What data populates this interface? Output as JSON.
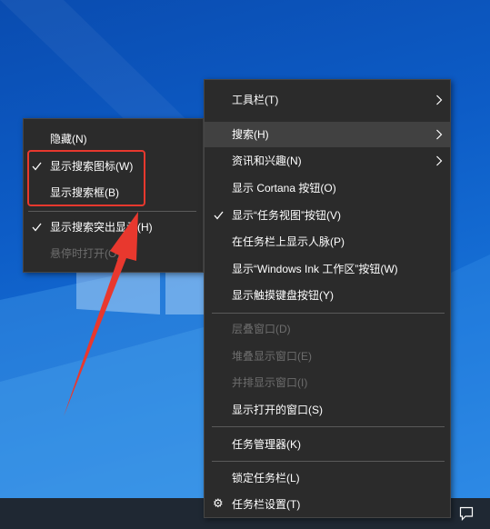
{
  "taskbar": {
    "notification_icon": "action-center-icon"
  },
  "context_menu": {
    "items": [
      {
        "label": "工具栏(T)",
        "submenu": true
      },
      {
        "label": "搜索(H)",
        "submenu": true,
        "highlighted": true
      },
      {
        "label": "资讯和兴趣(N)",
        "submenu": true
      },
      {
        "label": "显示 Cortana 按钮(O)"
      },
      {
        "label": "显示“任务视图”按钮(V)",
        "checked": true
      },
      {
        "label": "在任务栏上显示人脉(P)"
      },
      {
        "label": "显示“Windows Ink 工作区”按钮(W)"
      },
      {
        "label": "显示触摸键盘按钮(Y)"
      },
      {
        "label": "层叠窗口(D)",
        "disabled": true
      },
      {
        "label": "堆叠显示窗口(E)",
        "disabled": true
      },
      {
        "label": "并排显示窗口(I)",
        "disabled": true
      },
      {
        "label": "显示打开的窗口(S)"
      },
      {
        "label": "任务管理器(K)"
      },
      {
        "label": "锁定任务栏(L)"
      },
      {
        "label": "任务栏设置(T)",
        "icon": "gear-icon"
      }
    ]
  },
  "search_submenu": {
    "items": [
      {
        "label": "隐藏(N)"
      },
      {
        "label": "显示搜索图标(W)",
        "checked": true
      },
      {
        "label": "显示搜索框(B)"
      },
      {
        "label": "显示搜索突出显示(H)",
        "checked": true
      },
      {
        "label": "悬停时打开(O)",
        "disabled": true
      }
    ]
  },
  "colors": {
    "menu_bg": "#2b2b2b",
    "menu_highlight": "#414141",
    "text": "#ffffff",
    "disabled_text": "#6d6d6d",
    "annotation_red": "#e8382e",
    "taskbar": "#1f2833"
  }
}
